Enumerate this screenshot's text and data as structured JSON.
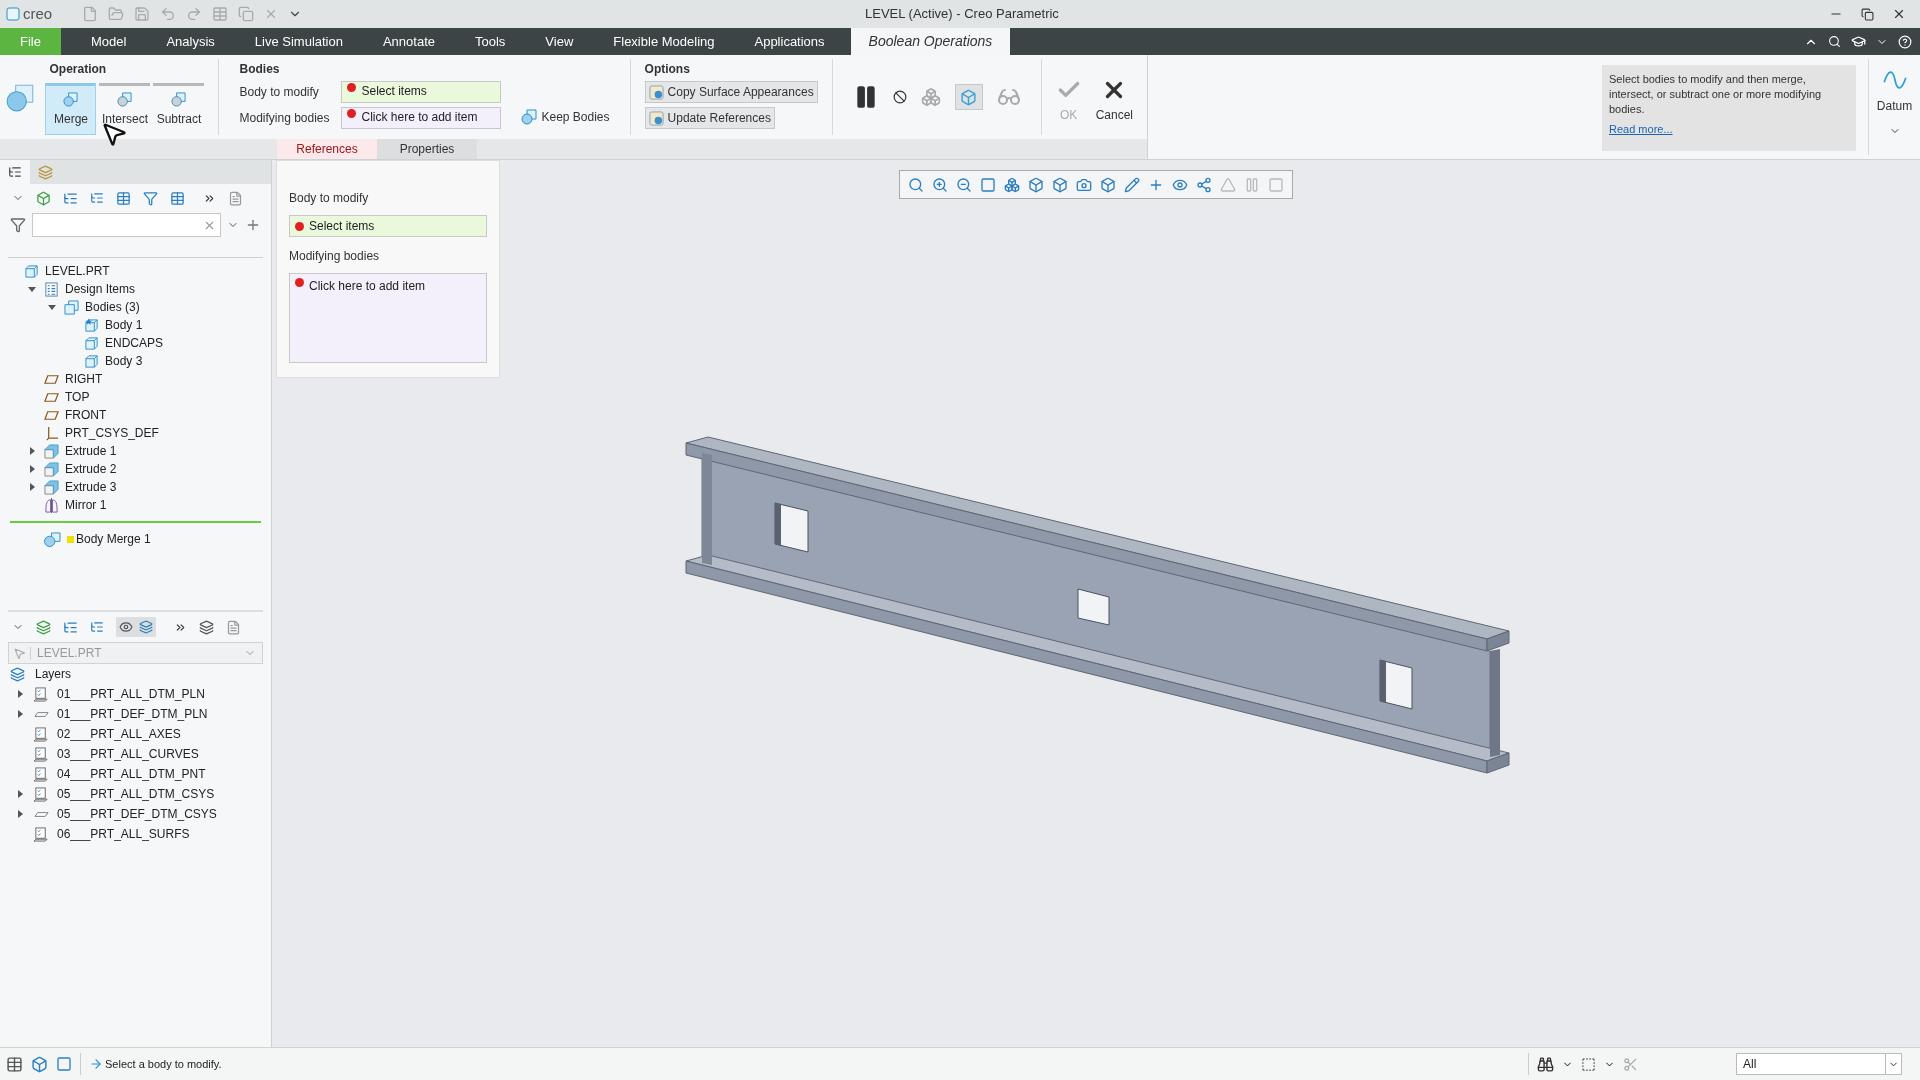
{
  "app": {
    "logo": "creo",
    "title": "LEVEL (Active) - Creo Parametric"
  },
  "menu_tabs": [
    {
      "label": "File",
      "kind": "file",
      "selected": false
    },
    {
      "label": "Model",
      "kind": "tab",
      "selected": false
    },
    {
      "label": "Analysis",
      "kind": "tab",
      "selected": false
    },
    {
      "label": "Live Simulation",
      "kind": "tab",
      "selected": false
    },
    {
      "label": "Annotate",
      "kind": "tab",
      "selected": false
    },
    {
      "label": "Tools",
      "kind": "tab",
      "selected": false
    },
    {
      "label": "View",
      "kind": "tab",
      "selected": false
    },
    {
      "label": "Flexible Modeling",
      "kind": "tab",
      "selected": false
    },
    {
      "label": "Applications",
      "kind": "tab",
      "selected": false
    },
    {
      "label": "Boolean Operations",
      "kind": "contextual",
      "selected": true
    }
  ],
  "ribbon": {
    "operation": {
      "title": "Operation",
      "buttons": [
        {
          "label": "Merge",
          "selected": true
        },
        {
          "label": "Intersect",
          "selected": false
        },
        {
          "label": "Subtract",
          "selected": false
        }
      ]
    },
    "bodies": {
      "title": "Bodies",
      "fields": [
        {
          "label": "Body to modify",
          "placeholder": "Select items",
          "active": true
        },
        {
          "label": "Modifying bodies",
          "placeholder": "Click here to add item",
          "active": false
        }
      ],
      "keep_bodies": "Keep Bodies"
    },
    "options": {
      "title": "Options",
      "buttons": [
        "Copy Surface Appearances",
        "Update References"
      ]
    },
    "actions": [
      {
        "label": "OK",
        "disabled": true
      },
      {
        "label": "Cancel",
        "disabled": false
      }
    ],
    "help": {
      "text": "Select bodies to modify and then merge, intersect, or subtract one or more modifying bodies.",
      "link": "Read more..."
    },
    "datum": "Datum",
    "panel_tabs": [
      {
        "label": "References",
        "selected": true
      },
      {
        "label": "Properties",
        "selected": false
      }
    ]
  },
  "references_panel": {
    "sections": [
      {
        "label": "Body to modify",
        "placeholder": "Select items",
        "active": true
      },
      {
        "label": "Modifying bodies",
        "placeholder": "Click here to add item",
        "active": false
      }
    ]
  },
  "model_tree": {
    "items": [
      {
        "label": "LEVEL.PRT",
        "kind": "part",
        "children": [
          {
            "label": "Design Items",
            "kind": "design",
            "expanded": true,
            "children": [
              {
                "label": "Bodies (3)",
                "kind": "bodies",
                "expanded": true,
                "children": [
                  {
                    "label": "Body 1",
                    "kind": "default_body"
                  },
                  {
                    "label": "ENDCAPS",
                    "kind": "body"
                  },
                  {
                    "label": "Body 3",
                    "kind": "body"
                  }
                ]
              }
            ]
          },
          {
            "label": "RIGHT",
            "kind": "plane"
          },
          {
            "label": "TOP",
            "kind": "plane"
          },
          {
            "label": "FRONT",
            "kind": "plane"
          },
          {
            "label": "PRT_CSYS_DEF",
            "kind": "csys"
          },
          {
            "label": "Extrude 1",
            "kind": "extrude",
            "expanded": false
          },
          {
            "label": "Extrude 2",
            "kind": "extrude",
            "expanded": false
          },
          {
            "label": "Extrude 3",
            "kind": "extrude",
            "expanded": false
          },
          {
            "label": "Mirror 1",
            "kind": "mirror"
          }
        ]
      }
    ],
    "after_insert": [
      {
        "label": "Body Merge 1",
        "kind": "merge"
      }
    ]
  },
  "layer_tree": {
    "selector": "LEVEL.PRT",
    "root": "Layers",
    "items": [
      {
        "label": "01___PRT_ALL_DTM_PLN",
        "kind": "layer",
        "expanded": false
      },
      {
        "label": "01___PRT_DEF_DTM_PLN",
        "kind": "empty_layer",
        "expanded": false
      },
      {
        "label": "02___PRT_ALL_AXES",
        "kind": "layer"
      },
      {
        "label": "03___PRT_ALL_CURVES",
        "kind": "layer"
      },
      {
        "label": "04___PRT_ALL_DTM_PNT",
        "kind": "layer"
      },
      {
        "label": "05___PRT_ALL_DTM_CSYS",
        "kind": "layer",
        "expanded": false
      },
      {
        "label": "05___PRT_DEF_DTM_CSYS",
        "kind": "empty_layer",
        "expanded": false
      },
      {
        "label": "06___PRT_ALL_SURFS",
        "kind": "layer"
      }
    ]
  },
  "status": {
    "message": "Select a body to modify.",
    "filter": "All"
  }
}
